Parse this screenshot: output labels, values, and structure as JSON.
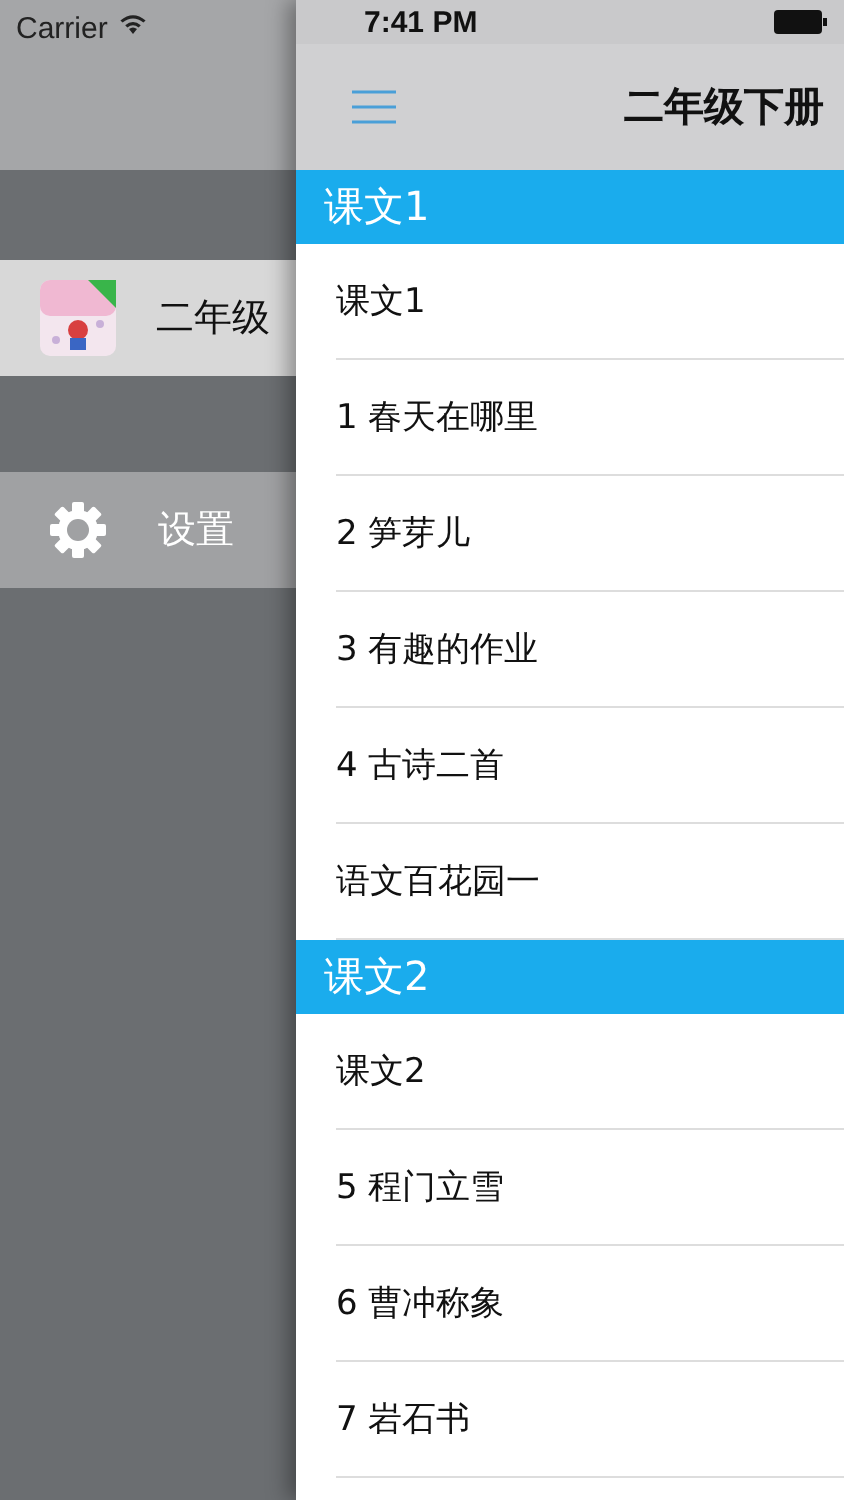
{
  "status_bar": {
    "carrier": "Carrier",
    "time": "7:41 PM"
  },
  "sidebar": {
    "items": [
      {
        "kind": "book",
        "label": "二年级",
        "selected": true
      },
      {
        "kind": "settings",
        "label": "设置",
        "selected": false
      }
    ]
  },
  "nav": {
    "title": "二年级下册"
  },
  "sections": [
    {
      "title": "课文1",
      "rows": [
        "课文1",
        "1 春天在哪里",
        "2 笋芽儿",
        "3 有趣的作业",
        "4 古诗二首",
        "语文百花园一"
      ]
    },
    {
      "title": "课文2",
      "rows": [
        "课文2",
        "5 程门立雪",
        "6 曹冲称象",
        "7 岩石书"
      ]
    }
  ]
}
